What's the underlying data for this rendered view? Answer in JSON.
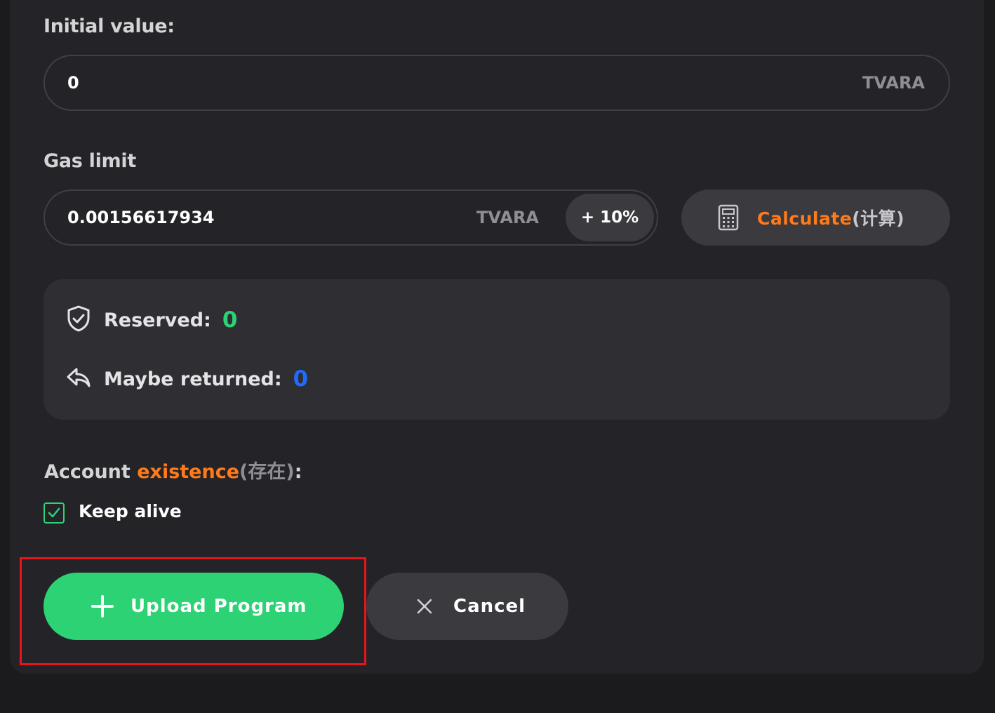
{
  "initial_value": {
    "label": "Initial value:",
    "value": "0",
    "unit": "TVARA"
  },
  "gas_limit": {
    "label": "Gas limit",
    "value": "0.00156617934",
    "unit": "TVARA",
    "increase_label": "+ 10%",
    "calculate_label": "Calculate",
    "calculate_suffix": "(计算)"
  },
  "gas_info": {
    "reserved_label": "Reserved:",
    "reserved_value": "0",
    "returned_label": "Maybe returned:",
    "returned_value": "0"
  },
  "account": {
    "label_prefix": "Account ",
    "label_highlight": "existence",
    "label_suffix": "(存在)",
    "label_colon": ":",
    "keep_alive_label": "Keep alive",
    "keep_alive_checked": true
  },
  "actions": {
    "upload_label": "Upload Program",
    "cancel_label": "Cancel"
  },
  "colors": {
    "accent_green": "#2dd274",
    "accent_orange": "#ff7a1a",
    "accent_blue": "#1f6bff",
    "highlight_red": "#e8141b"
  }
}
